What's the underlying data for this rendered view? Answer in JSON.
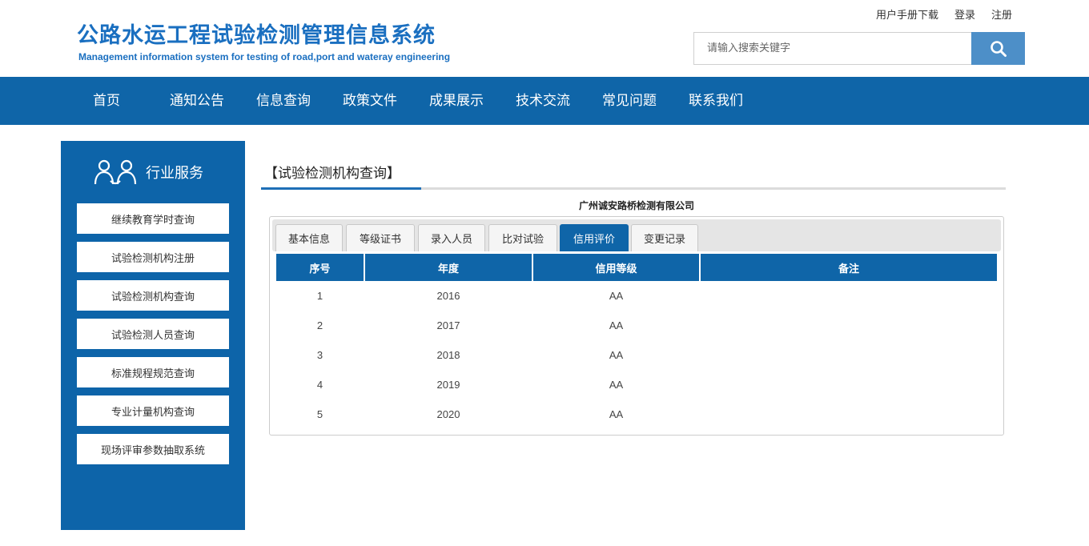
{
  "header": {
    "title": "公路水运工程试验检测管理信息系统",
    "subtitle": "Management information system for testing of road,port and wateray engineering",
    "links": [
      "用户手册下载",
      "登录",
      "注册"
    ],
    "search_placeholder": "请输入搜索关键字",
    "search_icon": "search-icon"
  },
  "nav": {
    "items": [
      "首页",
      "通知公告",
      "信息查询",
      "政策文件",
      "成果展示",
      "技术交流",
      "常见问题",
      "联系我们"
    ]
  },
  "sidebar": {
    "title": "行业服务",
    "icon": "people-icon",
    "items": [
      "继续教育学时查询",
      "试验检测机构注册",
      "试验检测机构查询",
      "试验检测人员查询",
      "标准规程规范查询",
      "专业计量机构查询",
      "现场评审参数抽取系统"
    ]
  },
  "main": {
    "title": "【试验检测机构查询】",
    "company": "广州诚安路桥检测有限公司",
    "tabs": [
      "基本信息",
      "等级证书",
      "录入人员",
      "比对试验",
      "信用评价",
      "变更记录"
    ],
    "active_tab": "信用评价",
    "table": {
      "headers": [
        "序号",
        "年度",
        "信用等级",
        "备注"
      ],
      "rows": [
        [
          "1",
          "2016",
          "AA",
          ""
        ],
        [
          "2",
          "2017",
          "AA",
          ""
        ],
        [
          "3",
          "2018",
          "AA",
          ""
        ],
        [
          "4",
          "2019",
          "AA",
          ""
        ],
        [
          "5",
          "2020",
          "AA",
          ""
        ]
      ]
    }
  },
  "colors": {
    "primary": "#0f65a8",
    "title_blue": "#1a6fc0",
    "search_button": "#4d8fc8"
  }
}
